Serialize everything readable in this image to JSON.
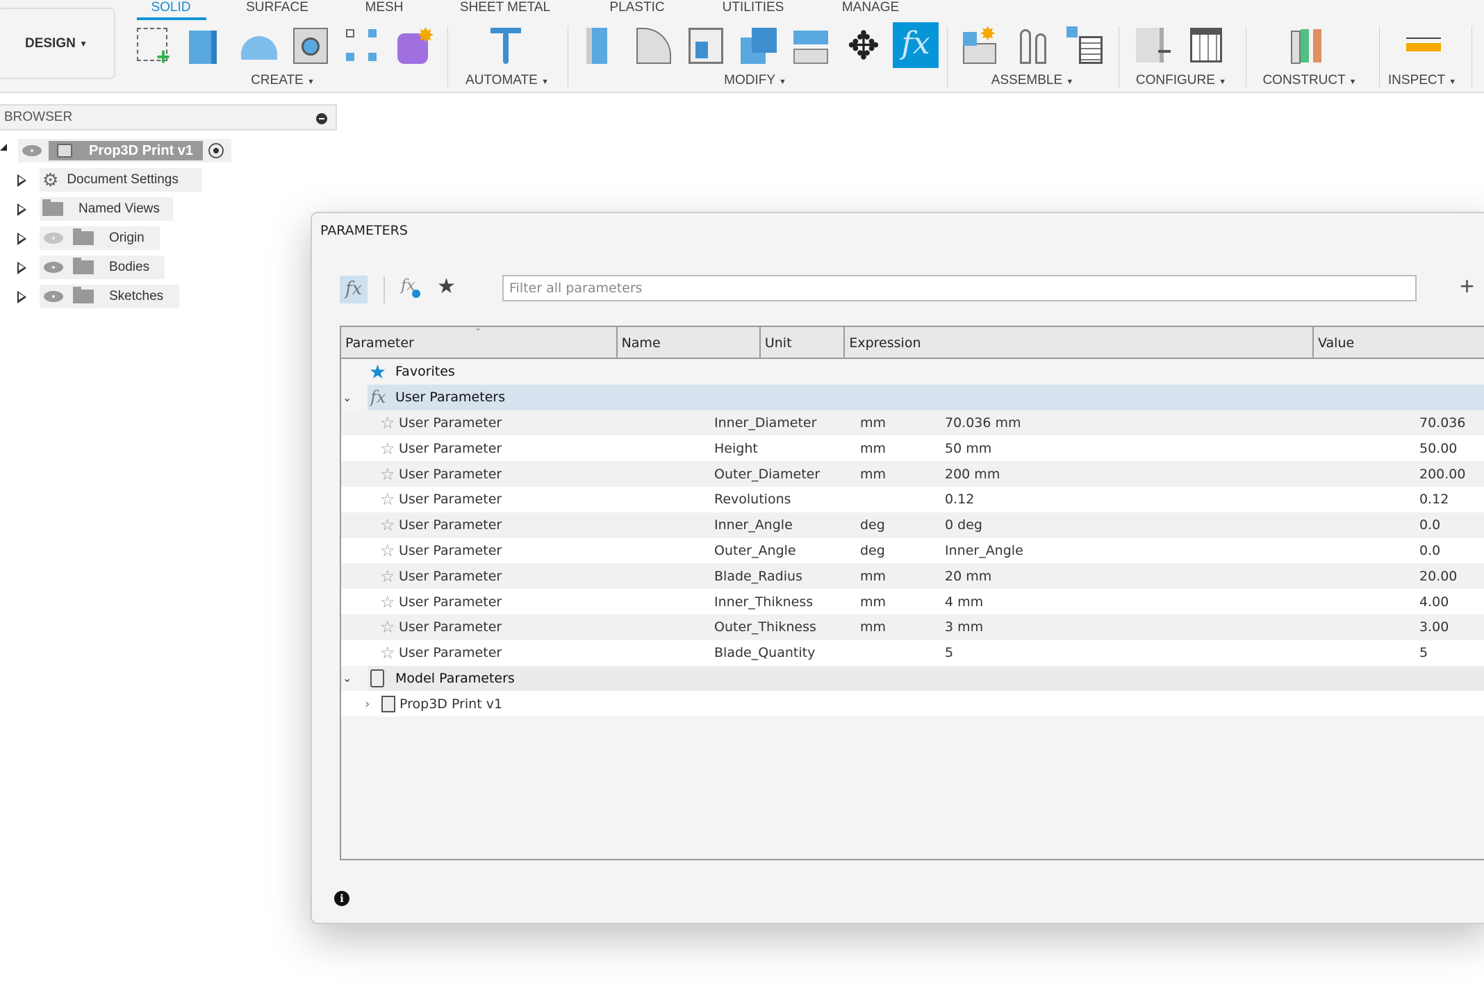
{
  "toolbar": {
    "workspace": "DESIGN",
    "tabs": [
      "SOLID",
      "SURFACE",
      "MESH",
      "SHEET METAL",
      "PLASTIC",
      "UTILITIES",
      "MANAGE"
    ],
    "active_tab": "SOLID",
    "groups": [
      "CREATE",
      "AUTOMATE",
      "MODIFY",
      "ASSEMBLE",
      "CONFIGURE",
      "CONSTRUCT",
      "INSPECT"
    ],
    "accent": "#0696d7"
  },
  "browser": {
    "title": "BROWSER",
    "root": "Prop3D Print v1",
    "items": [
      "Document Settings",
      "Named Views",
      "Origin",
      "Bodies",
      "Sketches"
    ]
  },
  "dialog": {
    "title": "PARAMETERS",
    "filter_placeholder": "Filter all parameters",
    "columns": [
      "Parameter",
      "Name",
      "Unit",
      "Expression",
      "Value"
    ],
    "favorites": "Favorites",
    "user_group": "User Parameters",
    "rows": [
      {
        "type": "User Parameter",
        "name": "Inner_Diameter",
        "unit": "mm",
        "expr": "70.036 mm",
        "value": "70.036"
      },
      {
        "type": "User Parameter",
        "name": "Height",
        "unit": "mm",
        "expr": "50 mm",
        "value": "50.00"
      },
      {
        "type": "User Parameter",
        "name": "Outer_Diameter",
        "unit": "mm",
        "expr": "200 mm",
        "value": "200.00"
      },
      {
        "type": "User Parameter",
        "name": "Revolutions",
        "unit": "",
        "expr": "0.12",
        "value": "0.12"
      },
      {
        "type": "User Parameter",
        "name": "Inner_Angle",
        "unit": "deg",
        "expr": "0 deg",
        "value": "0.0"
      },
      {
        "type": "User Parameter",
        "name": "Outer_Angle",
        "unit": "deg",
        "expr": "Inner_Angle",
        "value": "0.0"
      },
      {
        "type": "User Parameter",
        "name": "Blade_Radius",
        "unit": "mm",
        "expr": "20 mm",
        "value": "20.00"
      },
      {
        "type": "User Parameter",
        "name": "Inner_Thikness",
        "unit": "mm",
        "expr": "4 mm",
        "value": "4.00"
      },
      {
        "type": "User Parameter",
        "name": "Outer_Thikness",
        "unit": "mm",
        "expr": "3 mm",
        "value": "3.00"
      },
      {
        "type": "User Parameter",
        "name": "Blade_Quantity",
        "unit": "",
        "expr": "5",
        "value": "5"
      }
    ],
    "model_group": "Model Parameters",
    "model_child": "Prop3D Print v1"
  }
}
